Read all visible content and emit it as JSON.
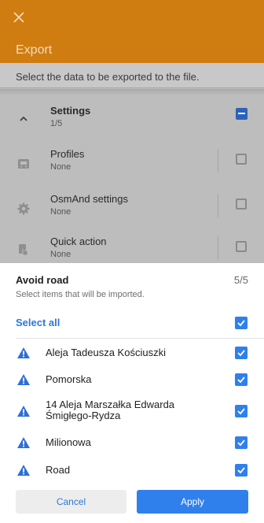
{
  "appbar": {
    "title": "Export",
    "close_icon": "close-icon",
    "color": "#cf7d10"
  },
  "background": {
    "subtitle": "Select the data to be exported to the file.",
    "rows": [
      {
        "title": "Settings",
        "sub": "1/5",
        "icon": "chevron-up-icon"
      },
      {
        "title": "Profiles",
        "sub": "None",
        "icon": "car-profile-icon"
      },
      {
        "title": "OsmAnd settings",
        "sub": "None",
        "icon": "gear-icon"
      },
      {
        "title": "Quick action",
        "sub": "None",
        "icon": "quick-action-icon"
      }
    ]
  },
  "sheet": {
    "title": "Avoid road",
    "count": "5/5",
    "description": "Select items that will be imported.",
    "select_all": "Select all",
    "items": [
      {
        "label": "Aleja Tadeusza Kościuszki",
        "checked": true
      },
      {
        "label": "Pomorska",
        "checked": true
      },
      {
        "label_line1": "14 Aleja Marszałka Edwarda",
        "label_line2": "Śmigłego-Rydza",
        "checked": true
      },
      {
        "label": "Milionowa",
        "checked": true
      },
      {
        "label": "Road",
        "checked": true
      }
    ],
    "cancel": "Cancel",
    "apply": "Apply"
  },
  "colors": {
    "accent": "#2f80ed",
    "link": "#2b78d8",
    "warning_icon": "#2f6fd6"
  }
}
